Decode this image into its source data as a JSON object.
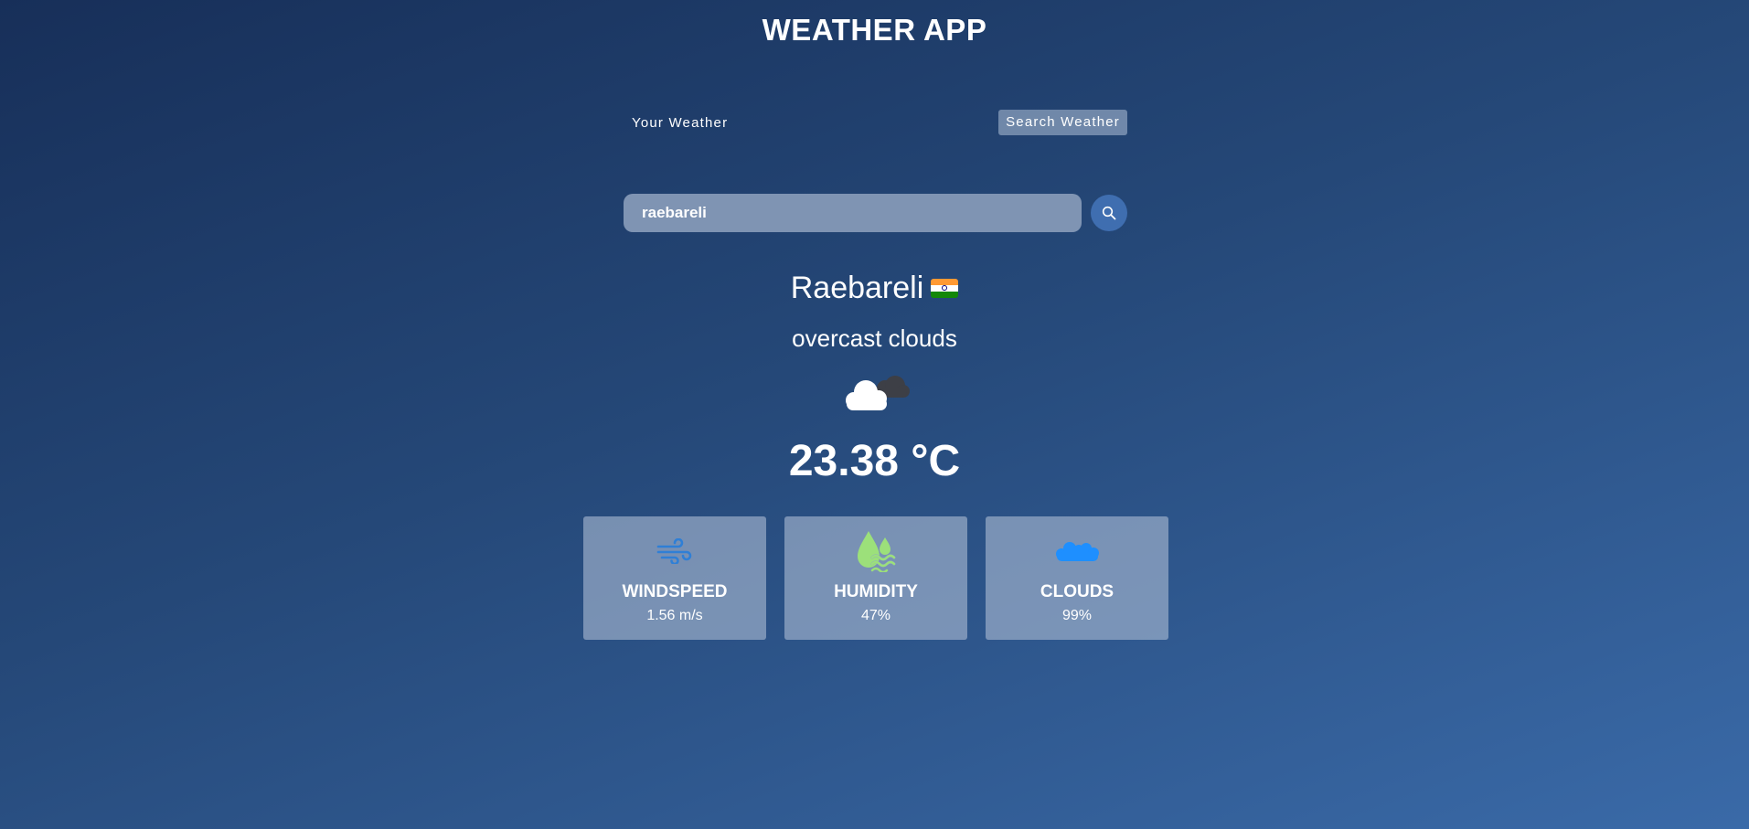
{
  "app": {
    "title": "WEATHER APP"
  },
  "tabs": {
    "your_weather": "Your Weather",
    "search_weather": "Search Weather"
  },
  "search": {
    "value": "raebareli",
    "placeholder": "Search for city..."
  },
  "weather": {
    "city": "Raebareli",
    "country_flag": "india-flag-icon",
    "description": "overcast clouds",
    "icon": "overcast-clouds-icon",
    "temperature": "23.38 °C"
  },
  "stats": {
    "windspeed": {
      "label": "WINDSPEED",
      "value": "1.56 m/s",
      "icon": "wind-icon",
      "color": "#2f7fd6"
    },
    "humidity": {
      "label": "HUMIDITY",
      "value": "47%",
      "icon": "humidity-icon",
      "color": "#9ce07a"
    },
    "clouds": {
      "label": "CLOUDS",
      "value": "99%",
      "icon": "cloud-icon",
      "color": "#1e8fff"
    }
  },
  "colors": {
    "background_start": "#172f59",
    "background_end": "#3a6aa8",
    "search_button": "#3f6eb0",
    "input_background": "#7f94b3"
  }
}
